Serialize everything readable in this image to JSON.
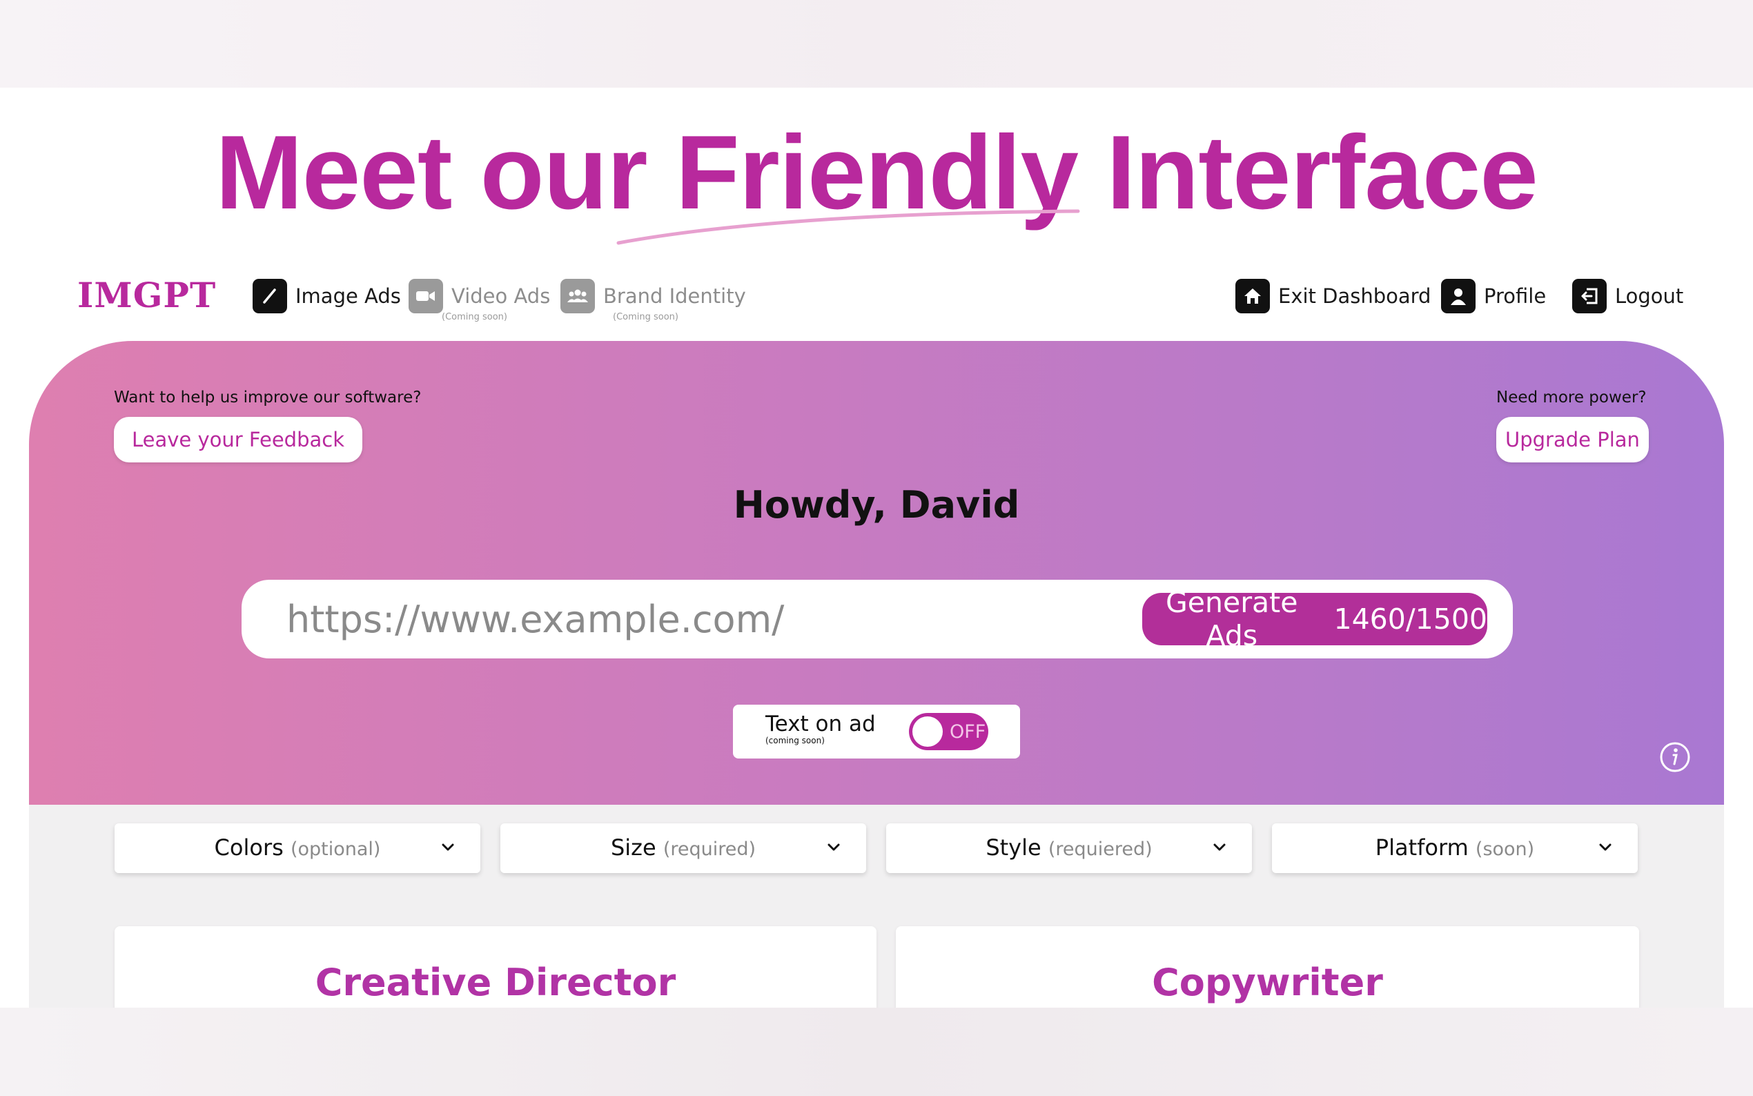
{
  "headline": "Meet our Friendly Interface",
  "logo": "IMGPT",
  "nav": {
    "image_ads": "Image Ads",
    "video_ads": "Video Ads",
    "video_ads_sub": "(Coming soon)",
    "brand_identity": "Brand Identity",
    "brand_identity_sub": "(Coming soon)",
    "exit_dashboard": "Exit Dashboard",
    "profile": "Profile",
    "logout": "Logout"
  },
  "hero": {
    "feedback_caption": "Want to help us improve our software?",
    "feedback_button": "Leave your Feedback",
    "upgrade_caption": "Need more power?",
    "upgrade_button": "Upgrade Plan",
    "greeting": "Howdy, David",
    "url_placeholder": "https://www.example.com/",
    "generate_label": "Generate Ads",
    "generate_count": "1460/1500",
    "toggle_label": "Text on ad",
    "toggle_sub": "(coming soon)",
    "toggle_state": "OFF"
  },
  "filters": [
    {
      "label": "Colors",
      "hint": "(optional)"
    },
    {
      "label": "Size",
      "hint": "(required)"
    },
    {
      "label": "Style",
      "hint": "(requiered)"
    },
    {
      "label": "Platform",
      "hint": "(soon)"
    }
  ],
  "cards": {
    "creative_director": "Creative Director",
    "copywriter": "Copywriter"
  },
  "colors": {
    "brand": "#b8299d",
    "button": "#b22f99",
    "gradient_start": "#de7fb0",
    "gradient_end": "#a978d2"
  },
  "icons": [
    "pencil-icon",
    "video-camera-icon",
    "people-icon",
    "home-icon",
    "user-icon",
    "logout-icon",
    "info-icon",
    "chevron-down-icon"
  ]
}
